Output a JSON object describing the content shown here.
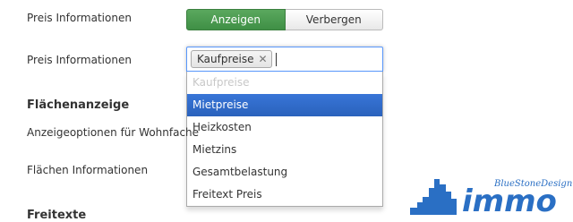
{
  "form": {
    "preis_toggle_label": "Preis Informationen",
    "toggle_on_label": "Anzeigen",
    "toggle_off_label": "Verbergen",
    "preis_select_label": "Preis Informationen",
    "selected_tokens": [
      "Kaufpreise"
    ],
    "section_flaechen": "Flächenanzeige",
    "anzeigeoptionen_label": "Anzeigeoptionen für Wohnfache",
    "flaechen_info_label": "Flächen Informationen",
    "section_freitexte": "Freitexte"
  },
  "dropdown": {
    "options": [
      {
        "label": "Kaufpreise",
        "state": "disabled"
      },
      {
        "label": "Mietpreise",
        "state": "highlighted"
      },
      {
        "label": "Heizkosten",
        "state": "normal"
      },
      {
        "label": "Mietzins",
        "state": "normal"
      },
      {
        "label": "Gesamtbelastung",
        "state": "normal"
      },
      {
        "label": "Freitext Preis",
        "state": "normal"
      }
    ]
  },
  "logo": {
    "brand": "immo",
    "tagline": "BlueStoneDesign"
  },
  "colors": {
    "toggle_active": "#3f8f45",
    "highlight": "#3875d7",
    "focus_border": "#5897fb",
    "logo_blue": "#2a6fc4"
  }
}
